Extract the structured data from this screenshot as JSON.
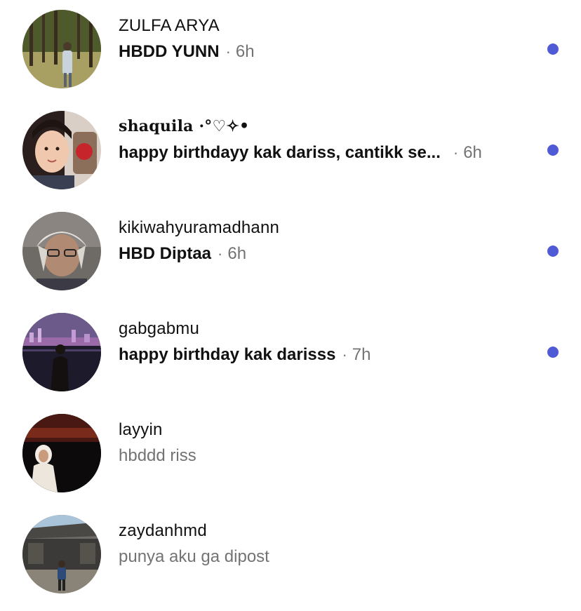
{
  "colors": {
    "unread_dot": "#4f5bd5",
    "muted_text": "#737373",
    "primary_text": "#111111"
  },
  "conversations": [
    {
      "name": "ZULFA ARYA",
      "message": "HBDD YUNN",
      "separator": "·",
      "time": "6h",
      "unread": true,
      "avatar": "avatar-forest-photo"
    },
    {
      "name": "shaquila ·°♡✧•",
      "message": "happy birthdayy kak dariss, cantikk se...",
      "separator": "·",
      "time": "6h",
      "unread": true,
      "avatar": "avatar-selfie-photo"
    },
    {
      "name": "kikiwahyuramadhann",
      "message": "HBD Diptaa",
      "separator": "·",
      "time": "6h",
      "unread": true,
      "avatar": "avatar-portrait-photo"
    },
    {
      "name": "gabgabmu",
      "message": "happy birthday kak darisss",
      "separator": "·",
      "time": "7h",
      "unread": true,
      "avatar": "avatar-night-city-photo"
    },
    {
      "name": "layyin",
      "message": "hbddd riss",
      "unread": false,
      "avatar": "avatar-sunset-photo"
    },
    {
      "name": "zaydanhmd",
      "message": "punya aku ga dipost",
      "unread": false,
      "avatar": "avatar-warehouse-photo"
    }
  ]
}
